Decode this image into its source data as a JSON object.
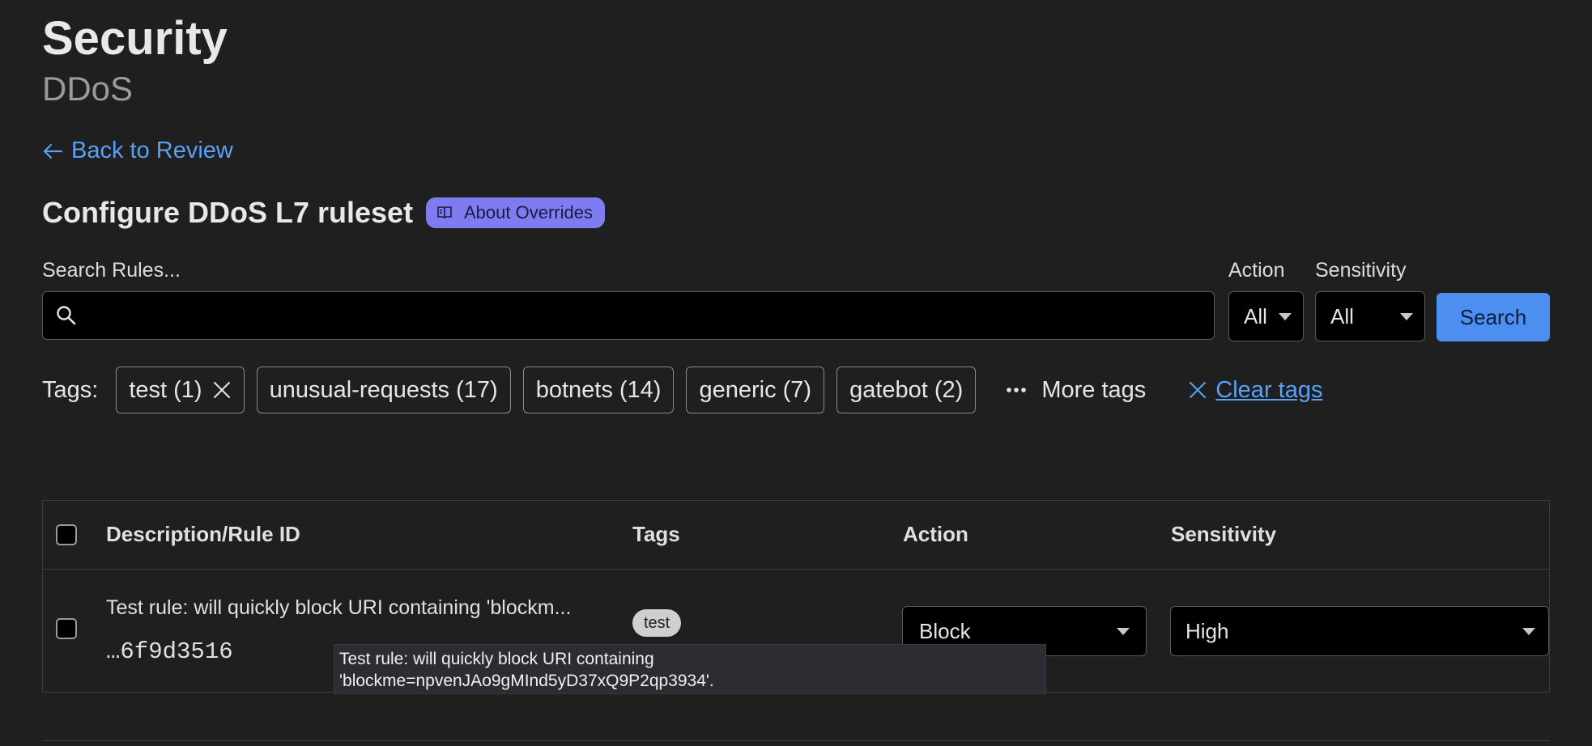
{
  "header": {
    "title": "Security",
    "subtitle": "DDoS"
  },
  "back_link": {
    "label": "Back to Review"
  },
  "section": {
    "title": "Configure DDoS L7 ruleset",
    "about_label": "About Overrides"
  },
  "filters": {
    "search_label": "Search Rules...",
    "search_value": "",
    "action_label": "Action",
    "action_value": "All",
    "sensitivity_label": "Sensitivity",
    "sensitivity_value": "All",
    "search_button": "Search"
  },
  "tags": {
    "label": "Tags:",
    "chips": [
      {
        "label": "test (1)"
      },
      {
        "label": "unusual-requests (17)"
      },
      {
        "label": "botnets (14)"
      },
      {
        "label": "generic (7)"
      },
      {
        "label": "gatebot (2)"
      }
    ],
    "more_label": "More tags",
    "clear_label": "Clear tags"
  },
  "table": {
    "columns": [
      "Description/Rule ID",
      "Tags",
      "Action",
      "Sensitivity"
    ],
    "rows": [
      {
        "description": "Test rule: will quickly block URI containing 'blockm...",
        "rule_id": "…6f9d3516",
        "tag": "test",
        "action": "Block",
        "sensitivity": "High"
      }
    ]
  },
  "tooltip": {
    "line1": "Test rule: will quickly block URI containing",
    "line2": "'blockme=npvenJAo9gMInd5yD37xQ9P2qp3934'."
  },
  "colors": {
    "background": "#1f1f1f",
    "link": "#5aa0f5",
    "primary_button": "#4d8ff0",
    "pill": "#7f7cf2"
  }
}
